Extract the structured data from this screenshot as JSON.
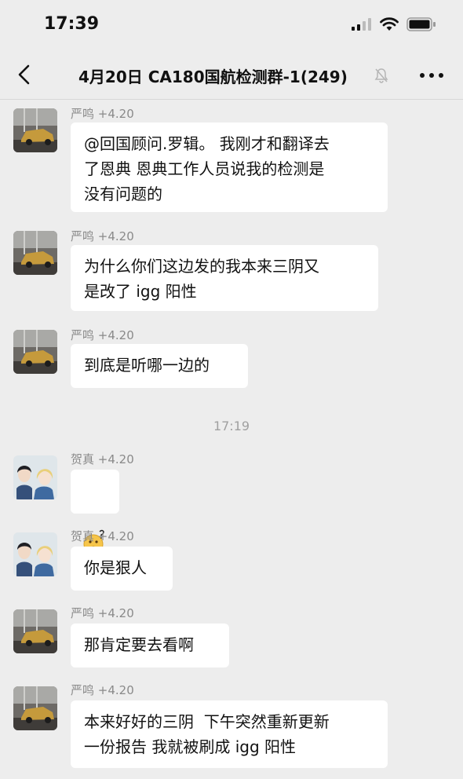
{
  "status": {
    "time": "17:39"
  },
  "header": {
    "title": "4月20日 CA180国航检测群-1(249)"
  },
  "messages": [
    {
      "sender": "严鸣 +4.20",
      "text": "@回国顾问.罗辑。 我刚才和翻译去\n了恩典 恩典工作人员说我的检测是\n没有问题的",
      "avatar": "car"
    },
    {
      "sender": "严鸣 +4.20",
      "text": "为什么你们这边发的我本来三阴又\n是改了 igg 阳性",
      "avatar": "car"
    },
    {
      "sender": "严鸣 +4.20",
      "text": "到底是听哪一边的",
      "avatar": "car"
    },
    {
      "sender": "贺真 +4.20",
      "text": "",
      "avatar": "couple",
      "emoji": "confused-face-emoji"
    },
    {
      "sender": "贺真 +4.20",
      "text": "你是狠人",
      "avatar": "couple"
    },
    {
      "sender": "严鸣 +4.20",
      "text": "那肯定要去看啊",
      "avatar": "car"
    },
    {
      "sender": "严鸣 +4.20",
      "text": "本来好好的三阴  下午突然重新更新\n一份报告 我就被刷成 igg 阳性",
      "avatar": "car"
    }
  ],
  "time_separator": "17:19"
}
